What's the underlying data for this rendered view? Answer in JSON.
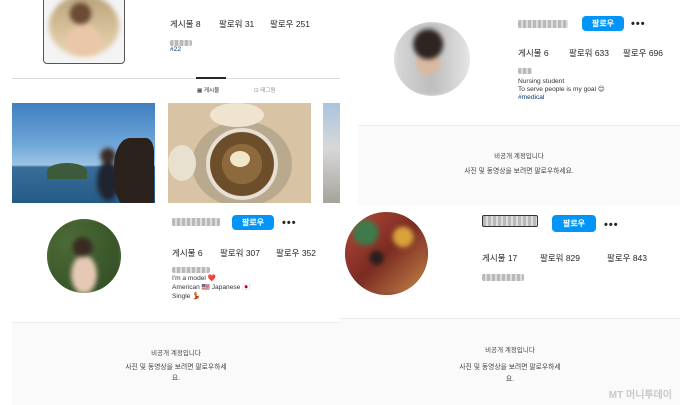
{
  "profiles": [
    {
      "id": "top-left",
      "posts_label": "게시물 8",
      "followers_label": "팔로워 31",
      "following_label": "팔로우 251",
      "hashtag": "#22",
      "tabs": [
        "게시물",
        "태그됨"
      ]
    },
    {
      "id": "top-right",
      "follow_label": "팔로우",
      "more_label": "•••",
      "posts_label": "게시물 6",
      "followers_label": "팔로워 633",
      "following_label": "팔로우 696",
      "bio_lines": [
        "Nursing student",
        "To serve people is my goal 😊"
      ],
      "hashtag": "#medical",
      "private_title": "비공개 계정입니다",
      "private_sub": "사진 및 동영상을 보려면 팔로우하세요."
    },
    {
      "id": "bottom-left",
      "follow_label": "팔로우",
      "more_label": "•••",
      "posts_label": "게시물 6",
      "followers_label": "팔로워 307",
      "following_label": "팔로우 352",
      "bio_lines": [
        "I'm a model ❤️",
        "American 🇺🇸 Japanese 🇯🇵",
        "Single 💃"
      ],
      "private_title": "비공개 계정입니다",
      "private_sub_1": "사진 및 동영상을 보려면 팔로우하세",
      "private_sub_2": "요."
    },
    {
      "id": "bottom-right",
      "follow_label": "팔로우",
      "more_label": "•••",
      "posts_label": "게시물 17",
      "followers_label": "팔로워 829",
      "following_label": "팔로우 843",
      "private_title": "비공개 계정입니다",
      "private_sub_1": "사진 및 동영상을 보려면 팔로우하세",
      "private_sub_2": "요."
    }
  ],
  "watermark": "MT 머니투데이",
  "colors": {
    "accent": "#0095f6",
    "hashtag": "#00376b"
  }
}
